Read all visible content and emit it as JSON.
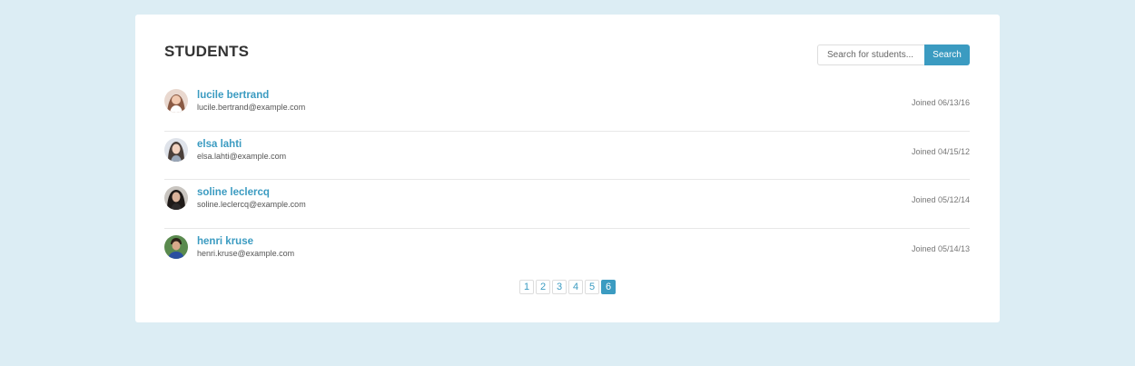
{
  "header": {
    "title": "STUDENTS"
  },
  "search": {
    "placeholder": "Search for students...",
    "value": "",
    "button_label": "Search"
  },
  "students": [
    {
      "name": "lucile bertrand",
      "email": "lucile.bertrand@example.com",
      "joined": "Joined 06/13/16",
      "avatar": "woman-avatar"
    },
    {
      "name": "elsa lahti",
      "email": "elsa.lahti@example.com",
      "joined": "Joined 04/15/12",
      "avatar": "woman-avatar"
    },
    {
      "name": "soline leclercq",
      "email": "soline.leclercq@example.com",
      "joined": "Joined 05/12/14",
      "avatar": "woman-avatar"
    },
    {
      "name": "henri kruse",
      "email": "henri.kruse@example.com",
      "joined": "Joined 05/14/13",
      "avatar": "man-avatar"
    }
  ],
  "pagination": {
    "pages": [
      "1",
      "2",
      "3",
      "4",
      "5",
      "6"
    ],
    "current": "6"
  },
  "colors": {
    "accent": "#3b9bc1",
    "background": "#dcedf4",
    "card": "#ffffff"
  }
}
